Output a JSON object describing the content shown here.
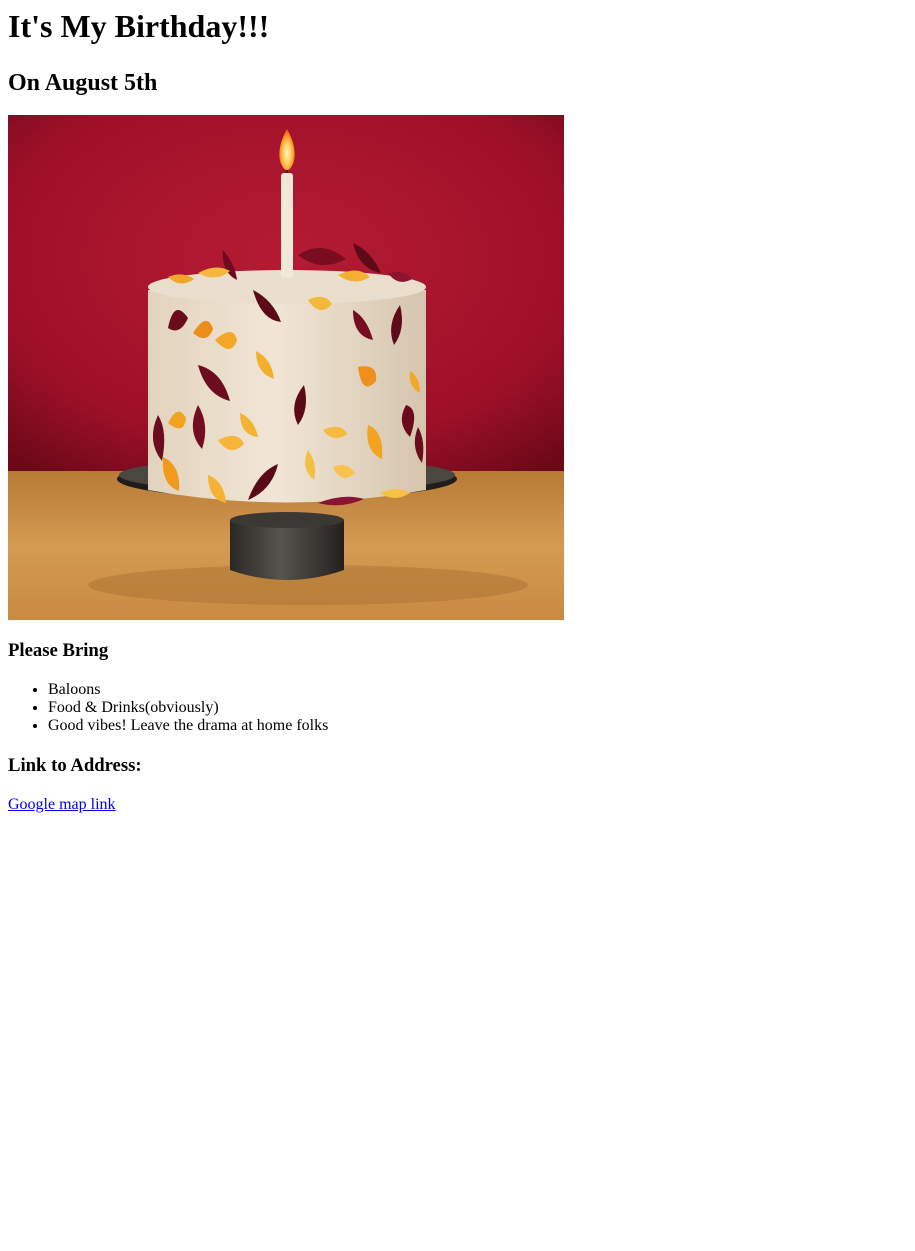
{
  "page": {
    "title": "It's My Birthday!!!",
    "subtitle": "On August 5th"
  },
  "image": {
    "subject": "cake-photo",
    "colors": {
      "backdrop": "#a4122a",
      "tabletop": "#c8893f",
      "frosting": "#eadfcd",
      "stand": "#3a3835"
    }
  },
  "bring": {
    "heading": "Please Bring",
    "items": [
      "Baloons",
      "Food & Drinks(obviously)",
      "Good vibes! Leave the drama at home folks"
    ]
  },
  "address": {
    "heading": "Link to Address:",
    "link_text": "Google map link"
  },
  "colors": {
    "link": "#0000ee",
    "text": "#000000",
    "background": "#ffffff"
  }
}
